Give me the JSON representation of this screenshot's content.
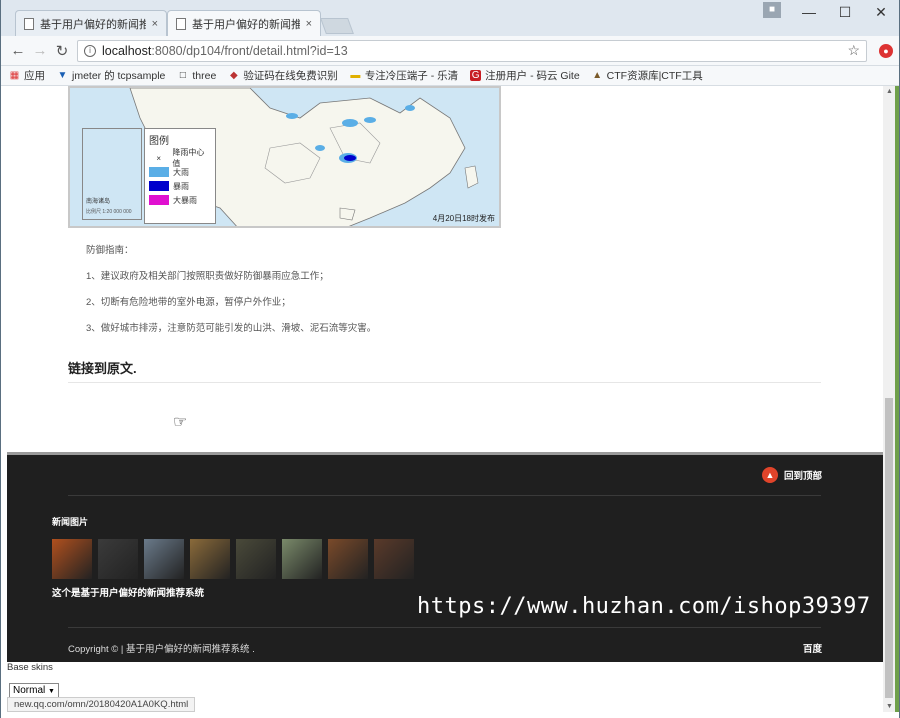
{
  "tabs": [
    {
      "title": "基于用户偏好的新闻推荐",
      "close": "×"
    },
    {
      "title": "基于用户偏好的新闻推荐",
      "close": "×"
    }
  ],
  "window": {
    "minimize": "—",
    "maximize": "☐",
    "close": "✕"
  },
  "address": {
    "host": "localhost",
    "rest": ":8080/dp104/front/detail.html?id=13"
  },
  "bookmarks": [
    {
      "label": "应用",
      "icon": "apps-grid-icon"
    },
    {
      "label": "jmeter 的 tcpsample",
      "icon": "shield-icon"
    },
    {
      "label": "three",
      "icon": "page-icon"
    },
    {
      "label": "验证码在线免费识别",
      "icon": "captcha-icon"
    },
    {
      "label": "专注冷压端子 - 乐清",
      "icon": "folder-icon"
    },
    {
      "label": "注册用户 - 码云 Gite",
      "icon": "gitee-icon"
    },
    {
      "label": "CTF资源库|CTF工具",
      "icon": "ctf-icon"
    }
  ],
  "map": {
    "legend_title": "图例",
    "legend": [
      {
        "label": "降雨中心值",
        "color": ""
      },
      {
        "label": "大雨",
        "color": "#5aaee6"
      },
      {
        "label": "暴雨",
        "color": "#0000cc"
      },
      {
        "label": "大暴雨",
        "color": "#e010d0"
      }
    ],
    "inset_label": "南海诸岛",
    "scale_label": "比例尺 1:20 000 000",
    "date": "4月20日18时发布"
  },
  "article": {
    "guide_title": "防御指南：",
    "guide_items": [
      "1、建议政府及相关部门按照职责做好防御暴雨应急工作；",
      "2、切断有危险地带的室外电源，暂停户外作业；",
      "3、做好城市排涝，注意防范可能引发的山洪、滑坡、泥石流等灾害。"
    ],
    "link_text": "链接到原文."
  },
  "footer": {
    "back_to_top": "回到顶部",
    "news_images_title": "新闻图片",
    "system_title": "这个是基于用户偏好的新闻推荐系统",
    "copyright": "Copyright © | 基于用户偏好的新闻推荐系统 .",
    "baidu": "百度",
    "thumb_colors": [
      "#b0501e",
      "#3b3b3b",
      "#6a7a8a",
      "#8a6a3a",
      "#4a4a3a",
      "#7a8a6a",
      "#7a4a2a",
      "#5a3a2a"
    ]
  },
  "watermark": "https://www.huzhan.com/ishop39397",
  "skins": {
    "label": "Base skins",
    "selected": "Normal"
  },
  "status_url": "new.qq.com/omn/20180420A1A0KQ.html"
}
